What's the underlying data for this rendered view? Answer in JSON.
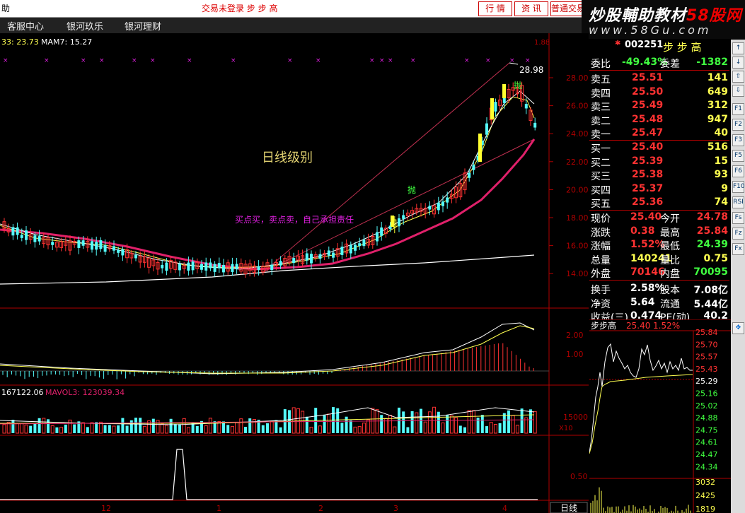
{
  "topbar": {
    "left": "助",
    "center": "交易未登录  步 步 高",
    "buttons": [
      "行 情",
      "资 讯",
      "普通交易"
    ]
  },
  "menu": [
    "客服中心",
    "银河玖乐",
    "银河理财"
  ],
  "watermark": {
    "part1": "炒股輔助教材",
    "part2": "58股网",
    "site": "www.58Gu.com"
  },
  "chart": {
    "ma_legend": "33: 23.73",
    "mam_legend": "MAM7: 15.27",
    "price_labels": [
      "28.00",
      "26.00",
      "24.00",
      "22.00",
      "20.00",
      "18.00",
      "16.00",
      "14.00"
    ],
    "peak_label": "28.98",
    "title_annotation": "日线级别",
    "note": "买点买，卖点卖，自己承担责任",
    "tag1": "抛",
    "tag2": "抛",
    "macd_labels": [
      "2.00",
      "1.00"
    ],
    "vol_legend_left": "167122.06",
    "vol_legend": "MAVOL3: 123039.34",
    "vol_labels": [
      "15000",
      "X10"
    ],
    "ind_label": "0.50",
    "x_labels": [
      "12",
      "1",
      "2",
      "3",
      "4"
    ],
    "period": "日线"
  },
  "quote": {
    "code": "002251",
    "name": "步 步 高",
    "weibi_label": "委比",
    "weibi": "-49.43%",
    "weicha_label": "委差",
    "weicha": "-1382",
    "asks": [
      {
        "label": "卖五",
        "price": "25.51",
        "vol": "141"
      },
      {
        "label": "卖四",
        "price": "25.50",
        "vol": "649"
      },
      {
        "label": "卖三",
        "price": "25.49",
        "vol": "312"
      },
      {
        "label": "卖二",
        "price": "25.48",
        "vol": "947"
      },
      {
        "label": "卖一",
        "price": "25.47",
        "vol": "40"
      }
    ],
    "bids": [
      {
        "label": "买一",
        "price": "25.40",
        "vol": "516"
      },
      {
        "label": "买二",
        "price": "25.39",
        "vol": "15"
      },
      {
        "label": "买三",
        "price": "25.38",
        "vol": "93"
      },
      {
        "label": "买四",
        "price": "25.37",
        "vol": "9"
      },
      {
        "label": "买五",
        "price": "25.36",
        "vol": "74"
      }
    ],
    "stats": [
      {
        "l1": "现价",
        "v1": "25.40",
        "l2": "今开",
        "v2": "24.78"
      },
      {
        "l1": "涨跌",
        "v1": "0.38",
        "l2": "最高",
        "v2": "25.84"
      },
      {
        "l1": "涨幅",
        "v1": "1.52%",
        "l2": "最低",
        "v2": "24.39"
      },
      {
        "l1": "总量",
        "v1": "140241",
        "l2": "量比",
        "v2": "0.75"
      },
      {
        "l1": "外盘",
        "v1": "70146",
        "l2": "内盘",
        "v2": "70095"
      },
      {
        "l1": "换手",
        "v1": "2.58%",
        "l2": "股本",
        "v2": "7.08亿"
      },
      {
        "l1": "净资",
        "v1": "5.64",
        "l2": "流通",
        "v2": "5.44亿"
      },
      {
        "l1": "收益(三)",
        "v1": "0.474",
        "l2": "PE(动)",
        "v2": "40.2"
      }
    ]
  },
  "mini": {
    "title": "步步高",
    "price": "25.40",
    "pct": "1.52%",
    "price_labels": [
      "25.84",
      "25.70",
      "25.57",
      "25.43",
      "25.29",
      "25.16",
      "25.02",
      "24.88",
      "24.75",
      "24.61",
      "24.47",
      "24.34"
    ],
    "vol_labels": [
      "3032",
      "2425",
      "1819"
    ]
  },
  "toolbar_icons": [
    "F1",
    "F2",
    "F3",
    "F5",
    "F6",
    "F10",
    "RSI",
    "Fs",
    "Fz",
    "Fx"
  ],
  "colors": {
    "up": "#ff3232",
    "down": "#54fcfc",
    "ma_pink": "#e0206a",
    "ma_white": "#ffffff",
    "ma_yellow": "#ffff50"
  }
}
